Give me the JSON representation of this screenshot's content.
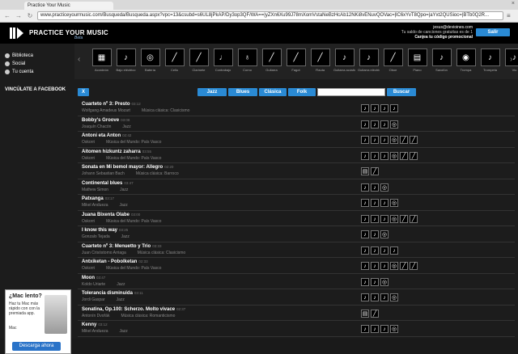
{
  "browser": {
    "tab_title": "Practice Your Music",
    "url": "www.practiceyourmusic.com/Busqueda/Busqueda.aspx?vpc=13&csubd=s6UL8jPkAP/Dy3op3QF/WA==|yZXn6Xu99J78mXomVstaNeBzHcAb12NKi8vENuvQOVac=|lC6xYvT8Qpo=|aYxt2QUSioc=|BTb0Q2R...",
    "close_glyph": "×",
    "back_glyph": "←",
    "forward_glyph": "→",
    "reload_glyph": "↻",
    "menu_glyph": "≡"
  },
  "header": {
    "logo": "PRACTICE YOUR MUSIC",
    "beta": "Beta",
    "email": "jesus@devioines.com",
    "saldo": "Tu saldo de canciones gratuitas es de 1",
    "promo": "Canjea tu código promocional",
    "login_label": "Salir"
  },
  "sidebar": {
    "items": [
      {
        "label": "Biblioteca",
        "icon": "library-icon"
      },
      {
        "label": "Social",
        "icon": "social-icon"
      },
      {
        "label": "Tu cuenta",
        "icon": "account-icon"
      }
    ],
    "facebook": "VINCÚLATE A FACEBOOK"
  },
  "ad": {
    "title": "¿Mac lento?",
    "body": "Haz tu Mac más rápido con con la premiada app.",
    "mac_label": "Mac",
    "button": "Descarga ahora"
  },
  "instruments": [
    {
      "label": "Acordeón",
      "glyph": "▦"
    },
    {
      "label": "Bajo eléctrico",
      "glyph": "♪"
    },
    {
      "label": "Batería",
      "glyph": "◎"
    },
    {
      "label": "Cello",
      "glyph": "╱"
    },
    {
      "label": "Clarinete",
      "glyph": "╱"
    },
    {
      "label": "Contrabajo",
      "glyph": "♩"
    },
    {
      "label": "Corno",
      "glyph": "♁"
    },
    {
      "label": "Guitarra",
      "glyph": "╱"
    },
    {
      "label": "Fagot",
      "glyph": "╱"
    },
    {
      "label": "Flauta",
      "glyph": "╱"
    },
    {
      "label": "Guitarra acústica",
      "glyph": "♪"
    },
    {
      "label": "Guitarra eléctrica",
      "glyph": "♪"
    },
    {
      "label": "Oboe",
      "glyph": "╱"
    },
    {
      "label": "Piano",
      "glyph": "▤"
    },
    {
      "label": "Saxofón",
      "glyph": "♪"
    },
    {
      "label": "Trompa",
      "glyph": "◉"
    },
    {
      "label": "Trompeta",
      "glyph": "♪"
    },
    {
      "label": "Vio",
      "glyph": "♪"
    }
  ],
  "filters": {
    "clear": "X",
    "jazz": "Jazz",
    "blues": "Blues",
    "clasica": "Clásica",
    "folk": "Folk",
    "search_placeholder": "",
    "search_btn": "Buscar"
  },
  "songs": [
    {
      "title": "Cuarteto nº 3: Presto",
      "dur": "03:12",
      "author": "Wolfgang Amadeus Mozart",
      "genre": "Música clásica: Clasicismo",
      "icons": [
        "♪",
        "♪",
        "♪",
        "♪"
      ]
    },
    {
      "title": "Bobby's Groove",
      "dur": "03:08",
      "author": "Joaquín Chacón",
      "genre": "Jazz",
      "icons": [
        "♪",
        "♪",
        "♪",
        "◎"
      ]
    },
    {
      "title": "Antoni eta Anton",
      "dur": "02:42",
      "author": "Oskorri",
      "genre": "Música del Mundo: País Vasco",
      "icons": [
        "♪",
        "♪",
        "♪",
        "◎",
        "╱",
        "╱"
      ]
    },
    {
      "title": "Aitomen hizkuntz zaharra",
      "dur": "03:55",
      "author": "Oskorri",
      "genre": "Música del Mundo: País Vasco",
      "icons": [
        "♪",
        "♪",
        "♪",
        "◎",
        "╱",
        "╱"
      ]
    },
    {
      "title": "Sonata en Mi bemol mayor: Allegro",
      "dur": "02:20",
      "author": "Johann Sebastian Bach",
      "genre": "Música clásica: Barroco",
      "icons": [
        "▤",
        "╱"
      ]
    },
    {
      "title": "Continental blues",
      "dur": "03:47",
      "author": "Mathew Simon",
      "genre": "Jazz",
      "icons": [
        "♪",
        "♪",
        "◎"
      ]
    },
    {
      "title": "Patxanga",
      "dur": "03:17",
      "author": "Mikel Andueza",
      "genre": "Jazz",
      "icons": [
        "♪",
        "♪",
        "♪",
        "◎"
      ]
    },
    {
      "title": "Juana Bixenta Olabe",
      "dur": "03:00",
      "author": "Oskorri",
      "genre": "Música del Mundo: País Vasco",
      "icons": [
        "♪",
        "♪",
        "♪",
        "◎",
        "╱",
        "╱"
      ]
    },
    {
      "title": "I know this way",
      "dur": "03:25",
      "author": "Gonzalo Tejada",
      "genre": "Jazz",
      "icons": [
        "♪",
        "♪",
        "◎"
      ]
    },
    {
      "title": "Cuarteto nº 3: Menuetto y Trio",
      "dur": "03:33",
      "author": "Juan Crisóstomo Arriaga",
      "genre": "Música clásica: Clasicismo",
      "icons": [
        "♪",
        "♪",
        "♪",
        "♪"
      ]
    },
    {
      "title": "Antxiketan - Pobolketan",
      "dur": "02:33",
      "author": "Oskorri",
      "genre": "Música del Mundo: País Vasco",
      "icons": [
        "♪",
        "♪",
        "♪",
        "◎",
        "╱",
        "╱"
      ]
    },
    {
      "title": "Moon",
      "dur": "03:47",
      "author": "Koldo Uriarte",
      "genre": "Jazz",
      "icons": [
        "♪",
        "♪",
        "◎"
      ]
    },
    {
      "title": "Tolerancia disminuida",
      "dur": "03:11",
      "author": "Jordi Gaspar",
      "genre": "Jazz",
      "icons": [
        "♪",
        "♪",
        "♪",
        "◎"
      ]
    },
    {
      "title": "Sonatina, Op.100: Scherzo. Molto vivace",
      "dur": "02:37",
      "author": "Antonín Dvořák",
      "genre": "Música clásica: Romanticismo",
      "icons": [
        "▤",
        "╱"
      ]
    },
    {
      "title": "Kenny",
      "dur": "03:12",
      "author": "Mikel Andueza",
      "genre": "Jazz",
      "icons": [
        "♪",
        "♪",
        "♪",
        "◎"
      ]
    }
  ]
}
